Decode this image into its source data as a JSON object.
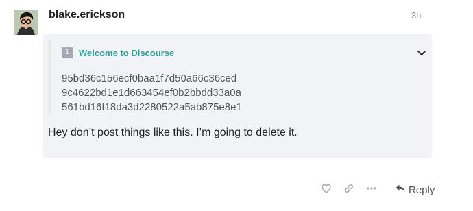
{
  "post": {
    "username": "blake.erickson",
    "date": "3h",
    "quote": {
      "badge": "1",
      "title": "Welcome to Discourse",
      "lines": [
        "95bd36c156ecf0baa1f7d50a66c36ced",
        "9c4622bd1e1d663454ef0b2bbdd33a0a",
        "561bd16f18da3d2280522a5ab875e8e1"
      ]
    },
    "body": "Hey don’t post things like this. I’m going to delete it."
  },
  "actions": {
    "reply_label": "Reply"
  },
  "colors": {
    "quote_title": "#2aa198",
    "post_background": "#f1f3f6",
    "badge": "#a3a8b3",
    "muted_icon": "#a3a8b3"
  },
  "icons": {
    "avatar": "user-avatar",
    "toggle": "chevron-down-icon",
    "like": "heart-icon",
    "link": "link-icon",
    "more": "ellipsis-icon",
    "reply": "reply-icon"
  }
}
